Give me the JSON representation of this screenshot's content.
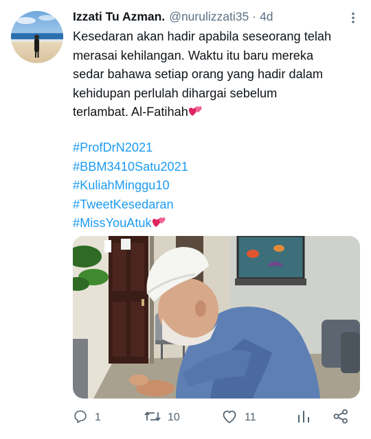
{
  "tweet": {
    "author_name": "Izzati Tu Azman.",
    "author_handle": "@nurulizzati35",
    "separator": "·",
    "timestamp": "4d",
    "text_lines": [
      "Kesedaran akan hadir apabila seseorang telah",
      "merasai kehilangan. Waktu itu baru mereka",
      "sedar bahawa setiap orang yang hadir dalam",
      "kehidupan perlulah dihargai sebelum",
      "terlambat. Al-Fatihah"
    ],
    "hashtags": [
      "#ProfDrN2021",
      "#BBM3410Satu2021",
      "#KuliahMinggu10",
      "#TweetKesedaran",
      "#MissYouAtuk"
    ],
    "emoji": "two-hearts-emoji"
  },
  "actions": {
    "reply_count": "1",
    "retweet_count": "10",
    "like_count": "11"
  },
  "icons": {
    "more": "more-options-icon",
    "reply": "reply-icon",
    "retweet": "retweet-icon",
    "like": "like-icon",
    "analytics": "analytics-icon",
    "share": "share-icon"
  },
  "colors": {
    "hashtag": "#1d9bf0",
    "meta": "#5b7083",
    "action": "#536471",
    "heart": "#e0245e"
  }
}
